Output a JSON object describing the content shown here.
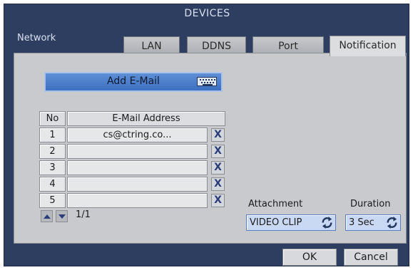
{
  "window": {
    "title": "DEVICES"
  },
  "section": {
    "label": "Network"
  },
  "tabs": [
    {
      "label": "LAN"
    },
    {
      "label": "DDNS"
    },
    {
      "label": "Port"
    },
    {
      "label": "Notification",
      "active": true
    }
  ],
  "add_email": {
    "label": "Add E-Mail",
    "icon": "keyboard-icon"
  },
  "table": {
    "headers": {
      "no": "No",
      "address": "E-Mail Address"
    },
    "rows": [
      {
        "no": "1",
        "address": "cs@ctring.co...",
        "delete_label": "X"
      },
      {
        "no": "2",
        "address": "",
        "delete_label": "X"
      },
      {
        "no": "3",
        "address": "",
        "delete_label": "X"
      },
      {
        "no": "4",
        "address": "",
        "delete_label": "X"
      },
      {
        "no": "5",
        "address": "",
        "delete_label": "X"
      }
    ]
  },
  "pagination": {
    "indicator": "1/1",
    "prev_icon": "arrow-up-icon",
    "next_icon": "arrow-down-icon"
  },
  "attachment": {
    "label": "Attachment",
    "value": "VIDEO CLIP",
    "icon": "cycle-icon"
  },
  "duration": {
    "label": "Duration",
    "value": "3 Sec",
    "icon": "cycle-icon"
  },
  "buttons": {
    "ok": "OK",
    "cancel": "Cancel"
  },
  "colors": {
    "frame": "#2e3e60",
    "panel": "#c8cacd",
    "accent": "#3c6fc0",
    "delete_x": "#2a3d7a"
  }
}
